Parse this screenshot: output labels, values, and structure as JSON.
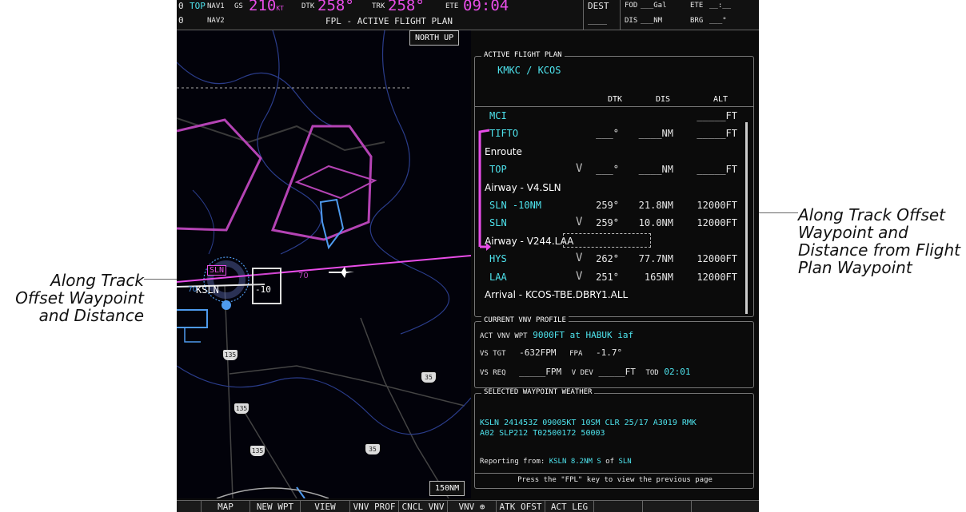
{
  "callouts": {
    "left": "Along Track\nOffset Waypoint\nand Distance",
    "right": "Along Track Offset\nWaypoint and\nDistance from Flight\nPlan Waypoint"
  },
  "topbar": {
    "row1": {
      "frag1": "0",
      "to_wpt": "TOP",
      "nav1": "NAV1",
      "gs_label": "GS",
      "gs_value": "210",
      "gs_unit": "KT",
      "dtk_label": "DTK",
      "dtk_value": "258°",
      "trk_label": "TRK",
      "trk_value": "258°",
      "ete_label": "ETE",
      "ete_value": "09:04",
      "dest": "DEST",
      "fod": "FOD",
      "fod_value": "___Gal",
      "ete2": "ETE",
      "ete2_value": "__:__"
    },
    "row2": {
      "frag1": "0",
      "nav2": "NAV2",
      "page_title": "FPL - ACTIVE FLIGHT PLAN",
      "dest_value": "____",
      "dis": "DIS",
      "dis_value": "___NM",
      "brg": "BRG",
      "brg_value": "___°"
    }
  },
  "map": {
    "orientation": "NORTH UP",
    "range": "150NM",
    "ats_distance": "-10",
    "airport_tag": "SLN",
    "airport_label": "KSLN",
    "airway_label": "70",
    "airway_label2": "70",
    "highways": [
      "135",
      "35",
      "135",
      "135",
      "35"
    ]
  },
  "fpl": {
    "title": "ACTIVE FLIGHT PLAN",
    "route": "KMKC / KCOS",
    "columns": {
      "dtk": "DTK",
      "dis": "DIS",
      "alt": "ALT"
    },
    "rows": [
      {
        "type": "wpt",
        "name": "MCI",
        "vnav": "",
        "dtk": "",
        "dis": "",
        "alt": "_____FT"
      },
      {
        "type": "wpt",
        "name": "TIFTO",
        "vnav": "",
        "dtk": "___°",
        "dis": "____NM",
        "alt": "_____FT"
      },
      {
        "type": "hdr",
        "name": "Enroute",
        "vnav": "",
        "dtk": "",
        "dis": "",
        "alt": ""
      },
      {
        "type": "wpt",
        "name": "TOP",
        "vnav": "V",
        "dtk": "___°",
        "dis": "____NM",
        "alt": "_____FT"
      },
      {
        "type": "hdr",
        "name": "Airway - V4.SLN",
        "vnav": "",
        "dtk": "",
        "dis": "",
        "alt": ""
      },
      {
        "type": "wpt",
        "name": "SLN -10NM",
        "vnav": "",
        "dtk": "259°",
        "dis": "21.8NM",
        "alt": "12000FT"
      },
      {
        "type": "wpt",
        "name": "SLN",
        "vnav": "V",
        "dtk": "259°",
        "dis": "10.0NM",
        "alt": "12000FT"
      },
      {
        "type": "hdr",
        "name": "Airway - V244.LAA",
        "vnav": "",
        "dtk": "",
        "dis": "",
        "alt": ""
      },
      {
        "type": "wpt",
        "name": "HYS",
        "vnav": "V",
        "dtk": "262°",
        "dis": "77.7NM",
        "alt": "12000FT"
      },
      {
        "type": "wpt",
        "name": "LAA",
        "vnav": "V",
        "dtk": "251°",
        "dis": "165NM",
        "alt": "12000FT"
      },
      {
        "type": "hdr",
        "name": "Arrival - KCOS-TBE.DBRY1.ALL",
        "vnav": "",
        "dtk": "",
        "dis": "",
        "alt": ""
      }
    ]
  },
  "vnv": {
    "title": "CURRENT VNV PROFILE",
    "act_label": "ACT VNV WPT",
    "act_alt": "9000FT",
    "at": "at",
    "act_wpt": "HABUK iaf",
    "vs_tgt_label": "VS TGT",
    "vs_tgt": "-632FPM",
    "fpa_label": "FPA",
    "fpa": "-1.7°",
    "vs_req_label": "VS REQ",
    "vs_req": "_____FPM",
    "vdev_label": "V DEV",
    "vdev": "_____FT",
    "tod_label": "TOD",
    "tod": "02:01"
  },
  "weather": {
    "title": "SELECTED WAYPOINT WEATHER",
    "metar": "KSLN 241453Z 09005KT 10SM CLR 25/17 A3019 RMK\nA02 SLP212 T02500172 50003",
    "reporting_label": "Reporting from:",
    "reporting_station": "KSLN",
    "reporting_dist": "8.2NM",
    "reporting_dir": "S",
    "of": "of",
    "reporting_wpt": "SLN"
  },
  "status": "Press the \"FPL\" key to view the previous page",
  "softkeys": [
    "MAP",
    "NEW WPT",
    "VIEW",
    "VNV PROF",
    "CNCL VNV",
    "VNV ⊕",
    "ATK OFST",
    "ACT LEG",
    "",
    ""
  ],
  "colors": {
    "cyan": "#4ee4ee",
    "magenta": "#e84de8",
    "background": "#0b0b0b"
  }
}
